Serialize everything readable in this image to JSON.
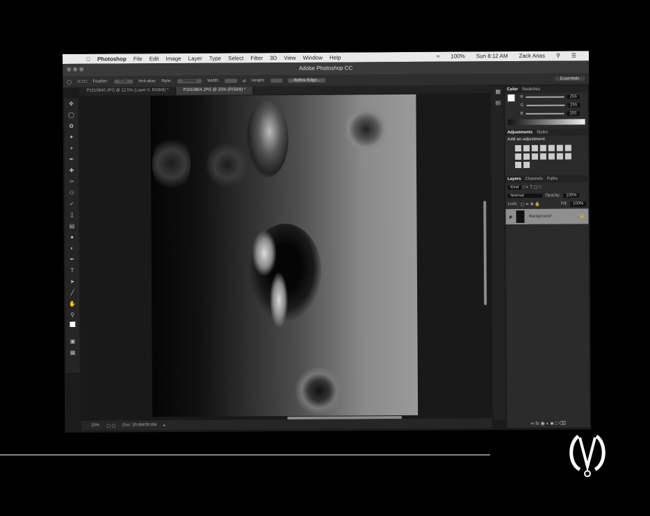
{
  "menubar": {
    "apple_icon": "apple-icon",
    "items": [
      "Photoshop",
      "File",
      "Edit",
      "Image",
      "Layer",
      "Type",
      "Select",
      "Filter",
      "3D",
      "View",
      "Window",
      "Help"
    ],
    "battery": "100%",
    "clock": "Sun 8:12 AM",
    "user": "Zack Arias"
  },
  "window": {
    "title": "Adobe Photoshop CC"
  },
  "options": {
    "feather_label": "Feather:",
    "feather_value": "0 px",
    "anti_alias": "Anti-alias",
    "style_label": "Style:",
    "style_value": "Normal",
    "width_label": "Width:",
    "height_label": "Height:",
    "refine_button": "Refine Edge...",
    "workspace": "Essentials"
  },
  "tabs": [
    {
      "label": "P1010840.JPG @ 12.5% (Layer 0, RGB/8) *"
    },
    {
      "label": "P1010854.JPG @ 25% (RGB/8) *"
    }
  ],
  "status": {
    "zoom": "25%",
    "doc": "Doc: 30.6M/30.6M"
  },
  "panels": {
    "color_tabs": [
      "Color",
      "Swatches"
    ],
    "rgb": [
      {
        "ch": "R",
        "value": "255"
      },
      {
        "ch": "G",
        "value": "255"
      },
      {
        "ch": "B",
        "value": "255"
      }
    ],
    "adj_tabs": [
      "Adjustments",
      "Styles"
    ],
    "adj_title": "Add an adjustment",
    "layer_tabs": [
      "Layers",
      "Channels",
      "Paths"
    ],
    "kind": "Kind",
    "blend": "Normal",
    "opacity_label": "Opacity:",
    "opacity": "100%",
    "lock_label": "Lock:",
    "fill_label": "Fill:",
    "fill": "100%",
    "layer_name": "Background"
  }
}
